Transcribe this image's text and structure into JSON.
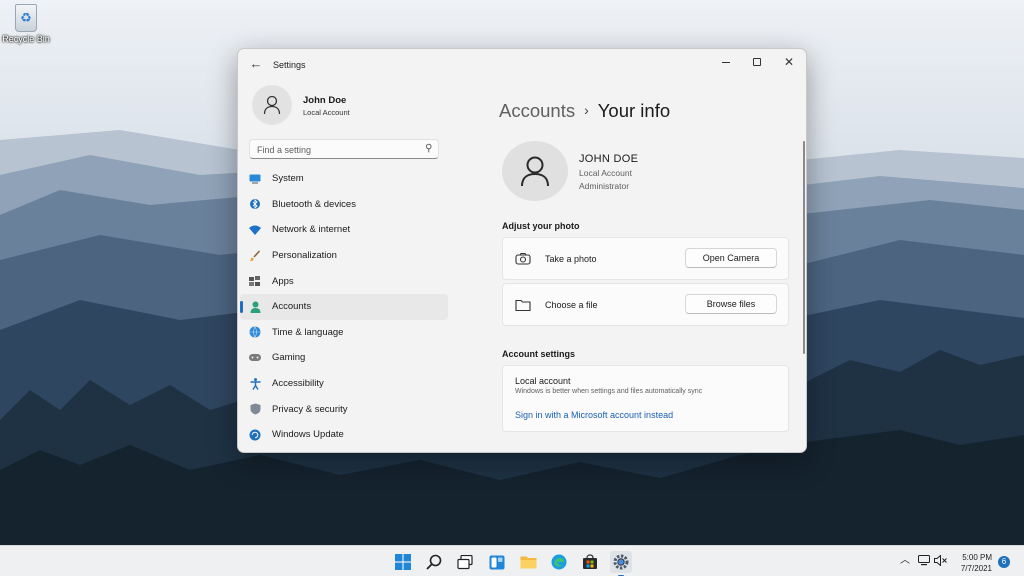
{
  "desktop": {
    "recycle_bin_label": "Recycle Bin"
  },
  "window": {
    "title": "Settings",
    "back_icon": "arrow-left-icon",
    "controls": [
      "minimize-icon",
      "maximize-icon",
      "close-icon"
    ]
  },
  "profile": {
    "name": "John Doe",
    "account_type": "Local Account"
  },
  "search": {
    "placeholder": "Find a setting",
    "icon": "search-icon"
  },
  "nav": {
    "items": [
      {
        "label": "System",
        "icon": "display-icon",
        "active": false
      },
      {
        "label": "Bluetooth & devices",
        "icon": "bluetooth-icon",
        "active": false
      },
      {
        "label": "Network & internet",
        "icon": "wifi-icon",
        "active": false
      },
      {
        "label": "Personalization",
        "icon": "brush-icon",
        "active": false
      },
      {
        "label": "Apps",
        "icon": "apps-icon",
        "active": false
      },
      {
        "label": "Accounts",
        "icon": "person-icon",
        "active": true
      },
      {
        "label": "Time & language",
        "icon": "globe-clock-icon",
        "active": false
      },
      {
        "label": "Gaming",
        "icon": "gamepad-icon",
        "active": false
      },
      {
        "label": "Accessibility",
        "icon": "accessibility-icon",
        "active": false
      },
      {
        "label": "Privacy & security",
        "icon": "shield-icon",
        "active": false
      },
      {
        "label": "Windows Update",
        "icon": "update-icon",
        "active": false
      }
    ]
  },
  "content": {
    "breadcrumb_parent": "Accounts",
    "breadcrumb_separator": "›",
    "breadcrumb_current": "Your info",
    "user": {
      "name": "JOHN DOE",
      "account_type": "Local Account",
      "role": "Administrator"
    },
    "adjust_photo": {
      "heading": "Adjust your photo",
      "take_photo": {
        "label": "Take a photo",
        "button": "Open Camera",
        "icon": "camera-icon"
      },
      "choose_file": {
        "label": "Choose a file",
        "button": "Browse files",
        "icon": "folder-icon"
      }
    },
    "account_settings": {
      "heading": "Account settings",
      "title": "Local account",
      "description": "Windows is better when settings and files automatically sync",
      "link": "Sign in with a Microsoft account instead"
    }
  },
  "taskbar": {
    "apps": [
      "start-icon",
      "search-icon",
      "task-view-icon",
      "widgets-icon",
      "file-explorer-icon",
      "edge-icon",
      "store-icon",
      "settings-icon"
    ],
    "active_app": "settings-icon",
    "tray": [
      "chevron-up-icon",
      "network-icon",
      "volume-mute-icon"
    ],
    "time": "5:00 PM",
    "date": "7/7/2021",
    "notification_count": "6"
  },
  "colors": {
    "accent": "#1f6fbf",
    "window_bg": "#f3f3f3",
    "card_bg": "#fbfbfb",
    "link": "#1a5fb4"
  }
}
